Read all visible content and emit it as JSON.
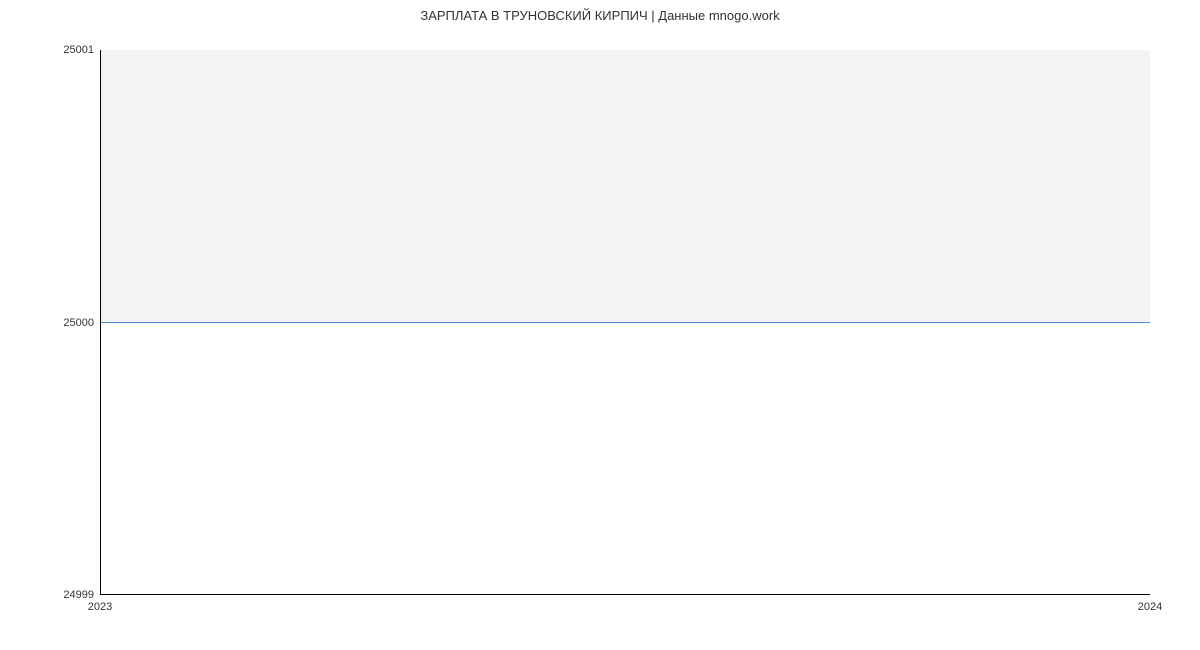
{
  "chart_data": {
    "type": "line",
    "title": "ЗАРПЛАТА В ТРУНОВСКИЙ КИРПИЧ | Данные mnogo.work",
    "x": [
      2023,
      2024
    ],
    "values": [
      25000,
      25000
    ],
    "xlabel": "",
    "ylabel": "",
    "ylim": [
      24999,
      25001
    ],
    "y_ticks": [
      "24999",
      "25000",
      "25001"
    ],
    "x_ticks": [
      "2023",
      "2024"
    ]
  }
}
